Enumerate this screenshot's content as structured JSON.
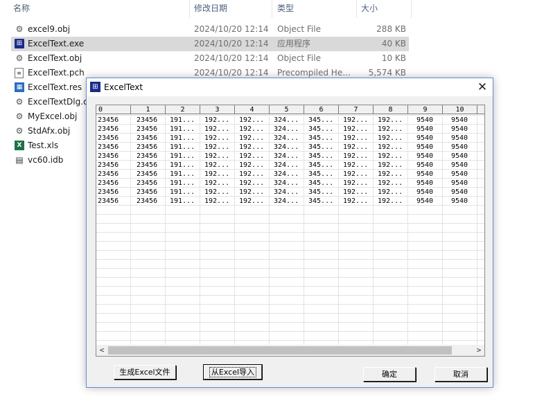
{
  "explorer": {
    "columns": {
      "name": "名称",
      "date": "修改日期",
      "type": "类型",
      "size": "大小"
    },
    "sort_indicator": "^",
    "files": [
      {
        "name": "excel9.obj",
        "date": "2024/10/20 12:14",
        "type": "Object File",
        "size": "288 KB",
        "icon": "obj-file-icon",
        "glyph": "⚙",
        "selected": false
      },
      {
        "name": "ExcelText.exe",
        "date": "2024/10/20 12:14",
        "type": "应用程序",
        "size": "40 KB",
        "icon": "exe-file-icon",
        "glyph": "⊞",
        "selected": true
      },
      {
        "name": "ExcelText.obj",
        "date": "2024/10/20 12:14",
        "type": "Object File",
        "size": "10 KB",
        "icon": "obj-file-icon",
        "glyph": "⚙",
        "selected": false
      },
      {
        "name": "ExcelText.pch",
        "date": "2024/10/20 12:14",
        "type": "Precompiled He...",
        "size": "5,574 KB",
        "icon": "pch-file-icon",
        "glyph": "≡",
        "selected": false
      },
      {
        "name": "ExcelText.res",
        "date": "",
        "type": "",
        "size": "",
        "icon": "res-file-icon",
        "glyph": "▦",
        "selected": false
      },
      {
        "name": "ExcelTextDlg.o",
        "date": "",
        "type": "",
        "size": "",
        "icon": "obj-file-icon",
        "glyph": "⚙",
        "selected": false
      },
      {
        "name": "MyExcel.obj",
        "date": "",
        "type": "",
        "size": "",
        "icon": "obj-file-icon",
        "glyph": "⚙",
        "selected": false
      },
      {
        "name": "StdAfx.obj",
        "date": "",
        "type": "",
        "size": "",
        "icon": "obj-file-icon",
        "glyph": "⚙",
        "selected": false
      },
      {
        "name": "Test.xls",
        "date": "",
        "type": "",
        "size": "",
        "icon": "xls-file-icon",
        "glyph": "X",
        "selected": false
      },
      {
        "name": "vc60.idb",
        "date": "",
        "type": "",
        "size": "",
        "icon": "idb-file-icon",
        "glyph": "▤",
        "selected": false
      }
    ]
  },
  "dialog": {
    "title": "ExcelText",
    "close_glyph": "✕",
    "app_icon_glyph": "⊞",
    "grid": {
      "headers": [
        "0",
        "1",
        "2",
        "3",
        "4",
        "5",
        "6",
        "7",
        "8",
        "9",
        "10"
      ],
      "row": [
        "23456",
        "23456",
        "191...",
        "192...",
        "192...",
        "324...",
        "345...",
        "192...",
        "192...",
        "9540",
        "9540"
      ],
      "row_count": 10,
      "scroll_left": "<",
      "scroll_right": ">"
    },
    "buttons": {
      "generate": "生成Excel文件",
      "import": "从Excel导入",
      "ok": "确定",
      "cancel": "取消"
    }
  }
}
